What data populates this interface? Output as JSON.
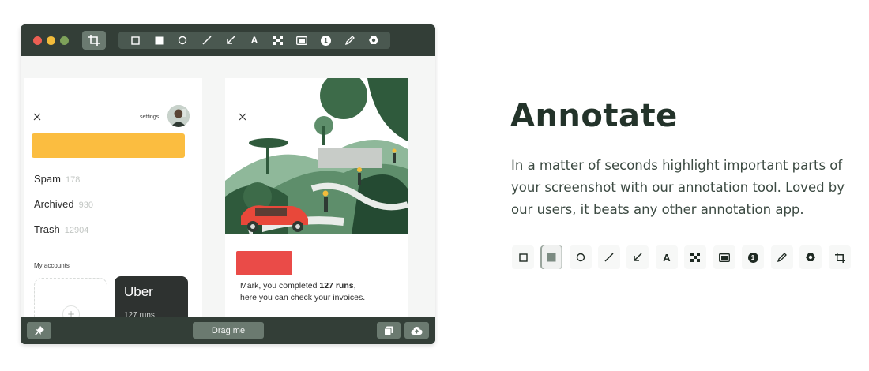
{
  "window": {
    "toolbar": {
      "crop_icon": "crop-icon",
      "tools": [
        "rectangle-outline-icon",
        "rectangle-filled-icon",
        "circle-icon",
        "line-icon",
        "arrow-icon",
        "text-icon",
        "pixelate-icon",
        "highlight-icon",
        "counter-icon",
        "pencil-icon",
        "blur-icon"
      ]
    },
    "mail_panel": {
      "settings_label": "settings",
      "rows": [
        {
          "label": "Spam",
          "count": "178"
        },
        {
          "label": "Archived",
          "count": "930"
        },
        {
          "label": "Trash",
          "count": "12904"
        }
      ],
      "accounts_label": "My accounts",
      "add_symbol": "+",
      "uber_card": {
        "title": "Uber",
        "runs": "127 runs"
      }
    },
    "card_panel": {
      "message_prefix": "Mark, you completed ",
      "message_bold": "127 runs",
      "message_middle": ",",
      "message_line2_prefix": "here you can check your ",
      "message_line2_bold": "invoices",
      "message_suffix": "."
    },
    "bottombar": {
      "drag_label": "Drag me"
    }
  },
  "marketing": {
    "title": "Annotate",
    "description": "In a matter of seconds highlight important parts of your screenshot with our annotation tool. Loved by our users, it beats any other annotation app."
  },
  "annotation_tools": [
    {
      "name": "rectangle-outline-icon",
      "selected": false
    },
    {
      "name": "rectangle-filled-icon",
      "selected": true
    },
    {
      "name": "circle-icon",
      "selected": false
    },
    {
      "name": "line-icon",
      "selected": false
    },
    {
      "name": "arrow-icon",
      "selected": false
    },
    {
      "name": "text-icon",
      "selected": false
    },
    {
      "name": "pixelate-icon",
      "selected": false
    },
    {
      "name": "highlight-icon",
      "selected": false
    },
    {
      "name": "counter-icon",
      "selected": false
    },
    {
      "name": "pencil-icon",
      "selected": false
    },
    {
      "name": "blur-icon",
      "selected": false
    },
    {
      "name": "crop-icon",
      "selected": false
    }
  ],
  "glyphs": {
    "text_tool": "A",
    "counter_tool": "1"
  },
  "colors": {
    "window_dark": "#333e37",
    "accent_yellow": "#fbbd40",
    "accent_red": "#ea4b48",
    "heading": "#23332a"
  }
}
